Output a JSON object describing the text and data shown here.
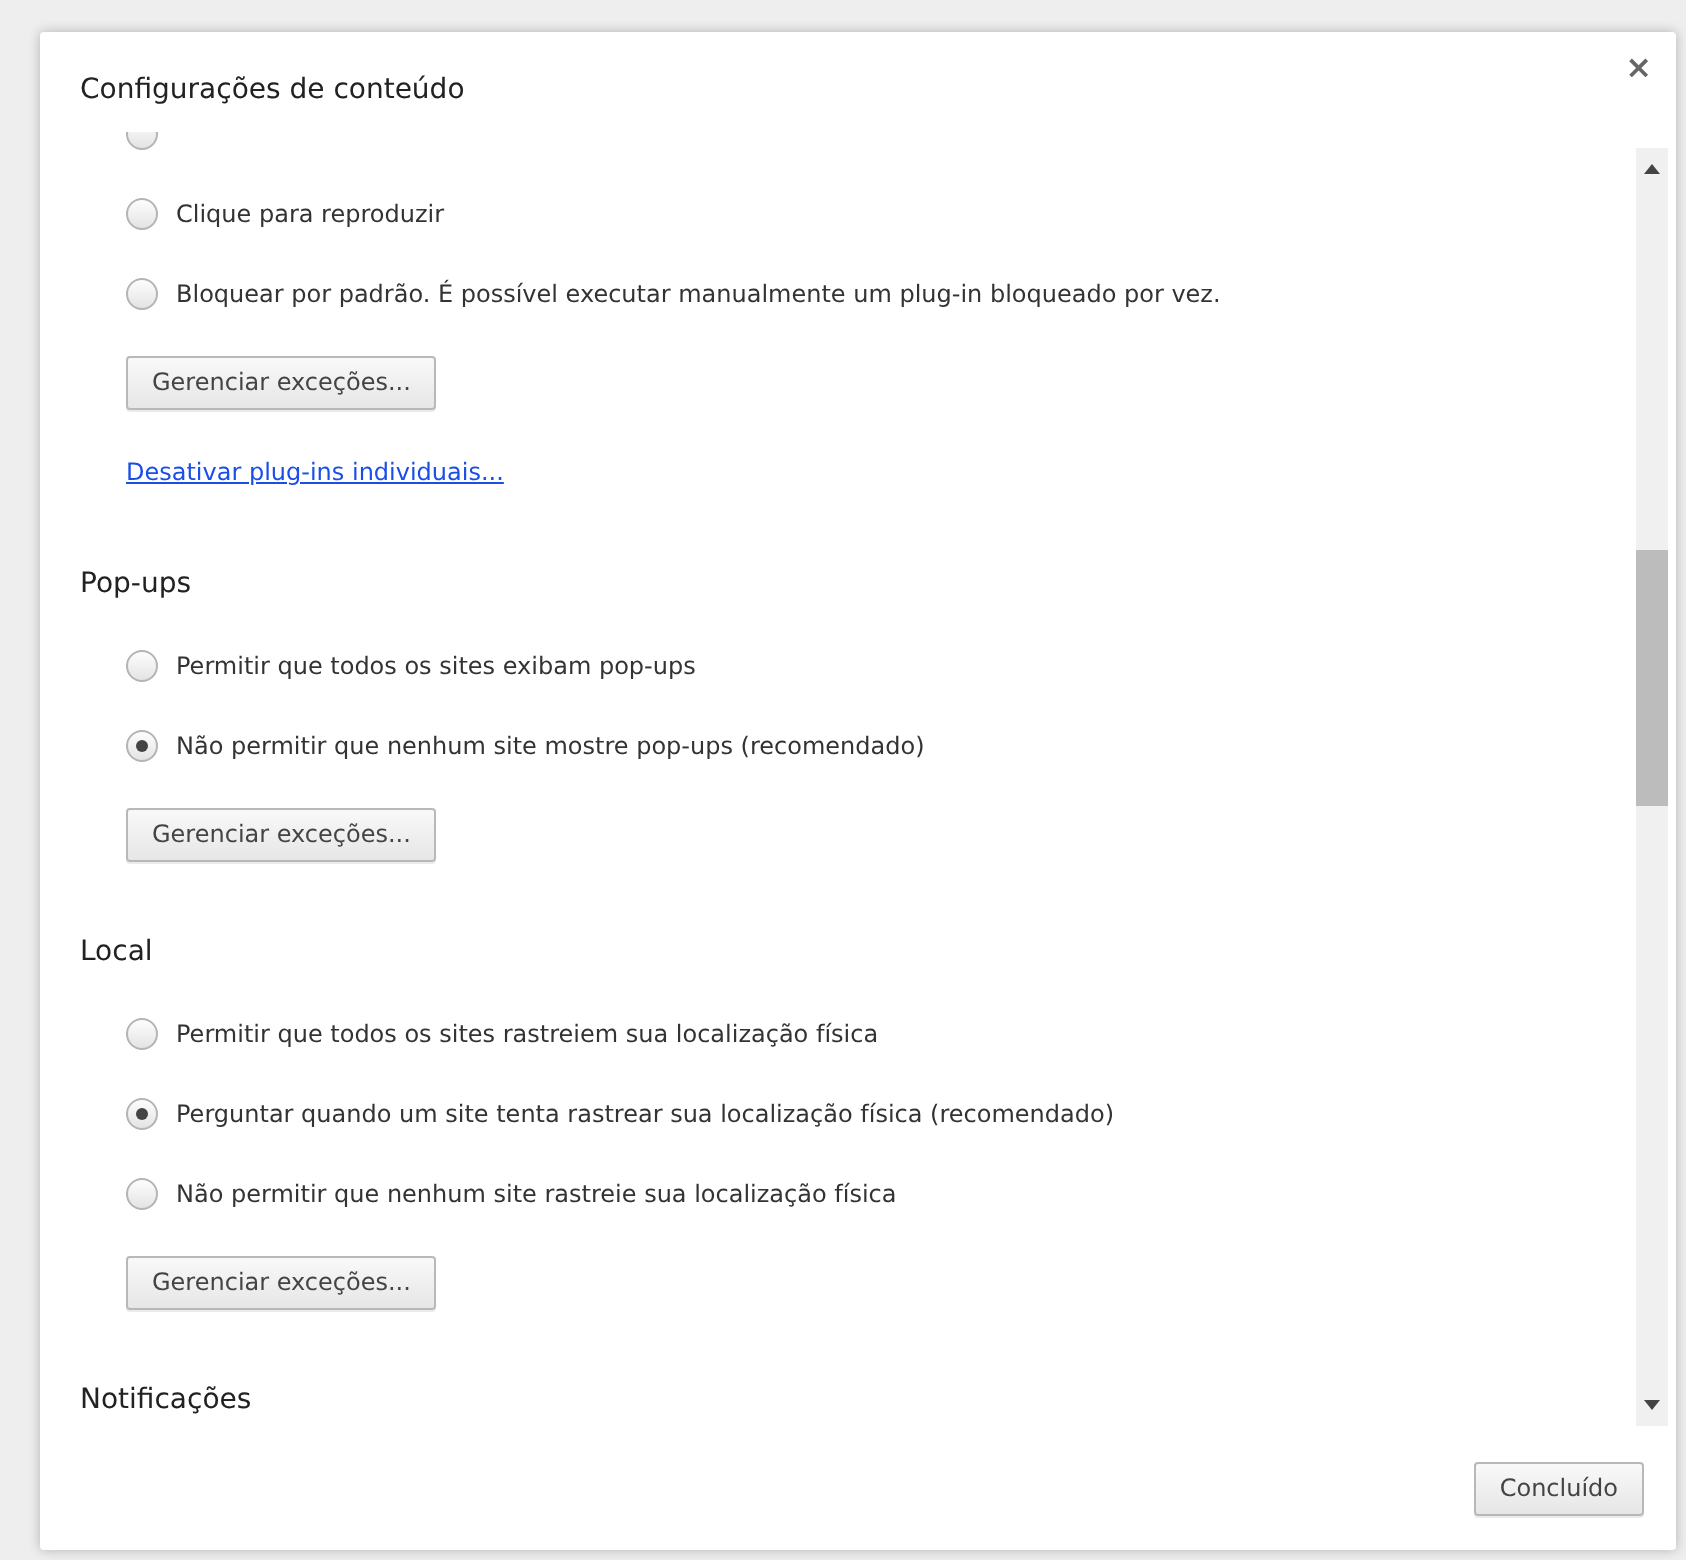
{
  "dialog": {
    "title": "Configurações de conteúdo",
    "close": "×",
    "done_button": "Concluído"
  },
  "sections": [
    {
      "items": [
        {
          "kind": "radio-cut",
          "selected": false
        },
        {
          "kind": "radio",
          "label": "Clique para reproduzir",
          "selected": false
        },
        {
          "kind": "radio",
          "label": "Bloquear por padrão. É possível executar manualmente um plug-in bloqueado por vez.",
          "selected": false
        },
        {
          "kind": "button",
          "label": "Gerenciar exceções..."
        },
        {
          "kind": "link",
          "label": "Desativar plug-ins individuais..."
        }
      ]
    },
    {
      "heading": "Pop-ups",
      "items": [
        {
          "kind": "radio",
          "label": "Permitir que todos os sites exibam pop-ups",
          "selected": false
        },
        {
          "kind": "radio",
          "label": "Não permitir que nenhum site mostre pop-ups (recomendado)",
          "selected": true
        },
        {
          "kind": "button",
          "label": "Gerenciar exceções..."
        }
      ]
    },
    {
      "heading": "Local",
      "items": [
        {
          "kind": "radio",
          "label": "Permitir que todos os sites rastreiem sua localização física",
          "selected": false
        },
        {
          "kind": "radio",
          "label": "Perguntar quando um site tenta rastrear sua localização física (recomendado)",
          "selected": true
        },
        {
          "kind": "radio",
          "label": "Não permitir que nenhum site rastreie sua localização física",
          "selected": false
        },
        {
          "kind": "button",
          "label": "Gerenciar exceções..."
        }
      ]
    },
    {
      "heading": "Notificações"
    }
  ]
}
